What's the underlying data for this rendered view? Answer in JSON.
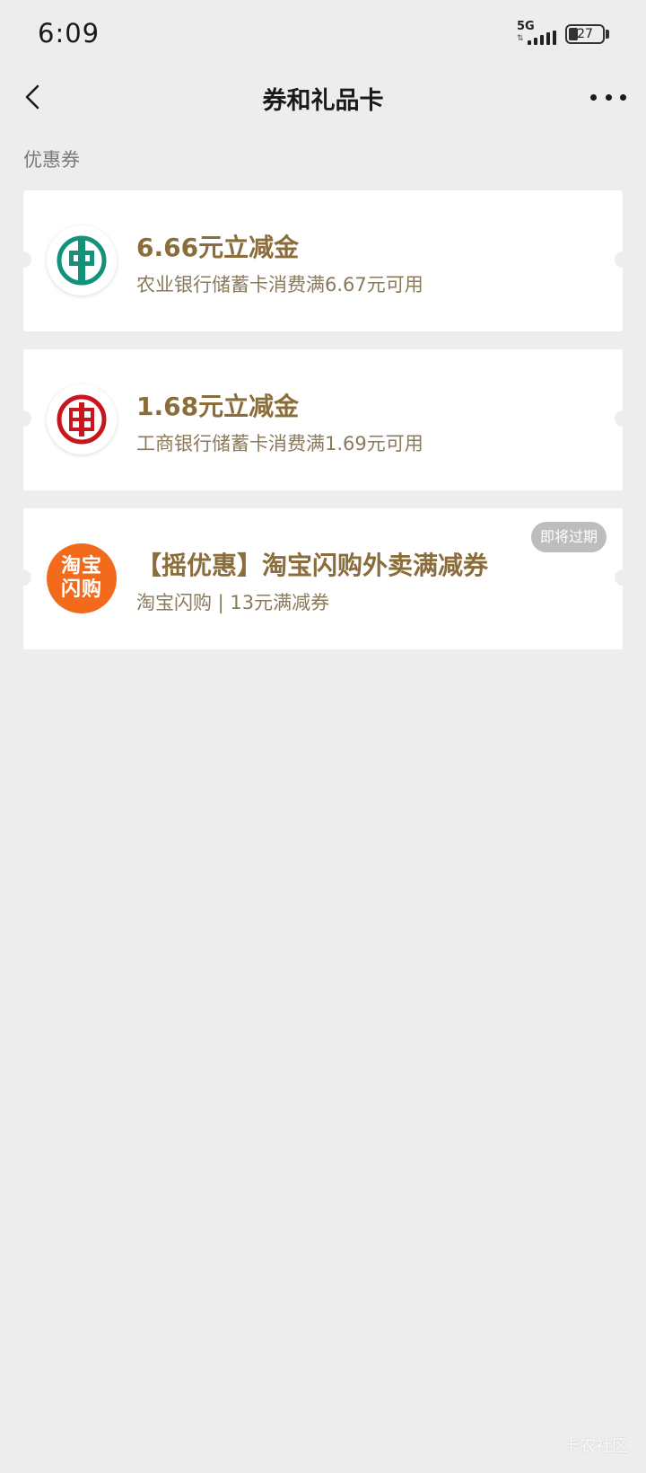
{
  "status_bar": {
    "time": "6:09",
    "network": "5G",
    "battery": "27"
  },
  "nav": {
    "title": "券和礼品卡"
  },
  "section": {
    "label": "优惠券"
  },
  "coupons": [
    {
      "title": "6.66元立减金",
      "desc": "农业银行储蓄卡消费满6.67元可用",
      "logo": "abc-bank-logo",
      "logo_color": "#12927a"
    },
    {
      "title": "1.68元立减金",
      "desc": "工商银行储蓄卡消费满1.69元可用",
      "logo": "icbc-bank-logo",
      "logo_color": "#c7161e"
    },
    {
      "title": "【摇优惠】淘宝闪购外卖满减券",
      "desc": "淘宝闪购 | 13元满减券",
      "logo": "taobao-shangou-logo",
      "logo_color": "#f26b1d",
      "logo_text": [
        "淘宝",
        "闪购"
      ],
      "badge": "即将过期"
    }
  ],
  "watermark": "卡农社区",
  "colors": {
    "background": "#ededed",
    "coupon_title": "#8a6d3b",
    "coupon_desc": "#8a7a5c"
  }
}
